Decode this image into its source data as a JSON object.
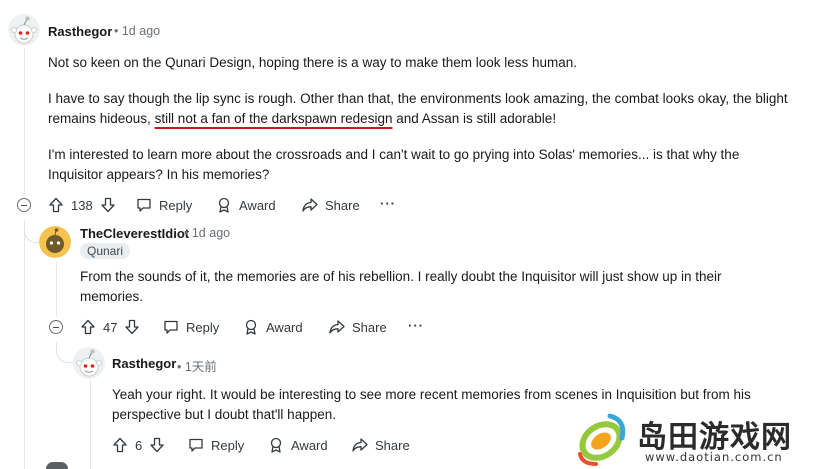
{
  "comments": [
    {
      "username": "Rasthegor",
      "time": "1d ago",
      "paragraphs": {
        "p1": "Not so keen on the Qunari Design, hoping there is a way to make them look less human.",
        "p2_before": "I have to say though the lip sync is rough. Other than that, the environments look amazing, the combat looks okay, the blight remains hideous, ",
        "p2_underlined": "still not a fan of the darkspawn redesign",
        "p2_after": " and Assan is still adorable!",
        "p3": "I'm interested to learn more about the crossroads and I can't wait to go prying into Solas' memories... is that why the Inquisitor appears? In his memories?"
      },
      "votes": "138",
      "reply": "Reply",
      "award": "Award",
      "share": "Share",
      "more": "···"
    },
    {
      "username": "TheCleverestIdiot",
      "time": "1d ago",
      "flair": "Qunari",
      "text": "From the sounds of it, the memories are of his rebellion. I really doubt the Inquisitor will just show up in their memories.",
      "votes": "47",
      "reply": "Reply",
      "award": "Award",
      "share": "Share",
      "more": "···"
    },
    {
      "username": "Rasthegor",
      "time": "1天前",
      "text": "Yeah your right. It would be interesting to see more recent memories from scenes in Inquisition but from his perspective but I doubt that'll happen.",
      "votes": "6",
      "reply": "Reply",
      "award": "Award",
      "share": "Share"
    }
  ],
  "watermark": {
    "title": "岛田游戏网",
    "url": "www.daotian.com.cn"
  },
  "colors": {
    "text": "#1a1a1b",
    "meta": "#6a7075",
    "underline": "#d0161f",
    "flair_bg": "#eaedef",
    "thread_line": "#e5e8ea"
  }
}
